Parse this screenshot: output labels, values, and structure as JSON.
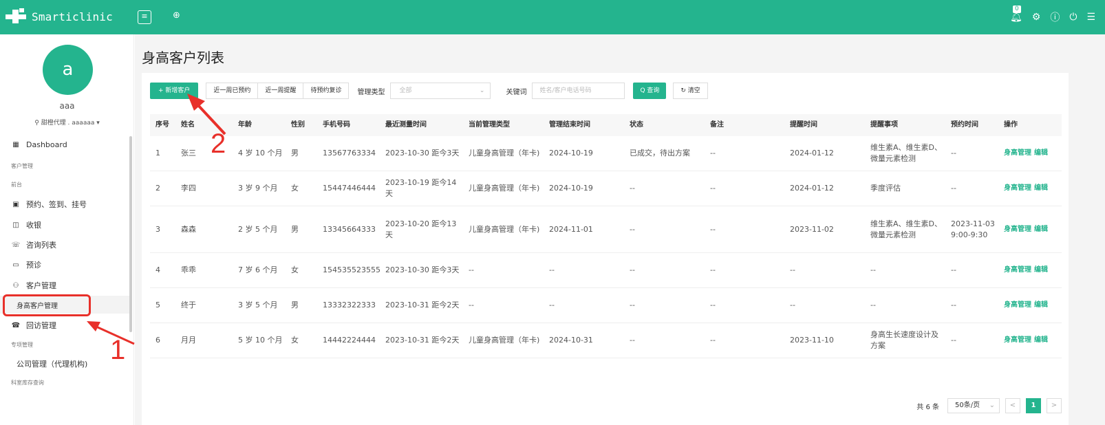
{
  "app": {
    "name": "Smarticlinic",
    "notification_count": "0"
  },
  "user": {
    "avatar_letter": "a",
    "name": "aaa",
    "location": "甜橙代理 . aaaaaa"
  },
  "sidebar": {
    "dashboard": "Dashboard",
    "sections": [
      "客户管理",
      "前台",
      "专项管理",
      "科室库存查询"
    ],
    "items": [
      "预约、签到、挂号",
      "收银",
      "咨询列表",
      "预诊",
      "客户管理",
      "身高客户管理",
      "回访管理",
      "公司管理（代理机构)"
    ]
  },
  "page": {
    "title": "身高客户列表"
  },
  "toolbar": {
    "add_label": "+ 新增客户",
    "filters": [
      "近一周已预约",
      "近一周提醒",
      "待预约复诊"
    ],
    "mgmt_type_label": "管理类型",
    "mgmt_type_value": "全部",
    "keyword_label": "关键词",
    "keyword_placeholder": "姓名/客户电话号码",
    "search_label": "Q 查询",
    "clear_label": "↻ 清空"
  },
  "table": {
    "columns": [
      "序号",
      "姓名",
      "年龄",
      "性别",
      "手机号码",
      "最近测量时间",
      "当前管理类型",
      "管理结束时间",
      "状态",
      "备注",
      "提醒时间",
      "提醒事项",
      "预约时间",
      "操作"
    ],
    "rows": [
      [
        "1",
        "张三",
        "4 岁 10 个月",
        "男",
        "13567763334",
        "2023-10-30 距今3天",
        "儿童身高管理（年卡)",
        "2024-10-19",
        "已成交，待出方案",
        "--",
        "2024-01-12",
        "维生素A、维生素D、微量元素检测",
        "--"
      ],
      [
        "2",
        "李四",
        "3 岁 9 个月",
        "女",
        "15447446444",
        "2023-10-19 距今14天",
        "儿童身高管理（年卡)",
        "2024-10-19",
        "--",
        "--",
        "2024-01-12",
        "季度评估",
        "--"
      ],
      [
        "3",
        "森森",
        "2 岁 5 个月",
        "男",
        "13345664333",
        "2023-10-20 距今13天",
        "儿童身高管理（年卡)",
        "2024-11-01",
        "--",
        "--",
        "2023-11-02",
        "维生素A、维生素D、微量元素检测",
        "2023-11-03 9:00-9:30"
      ],
      [
        "4",
        "乖乖",
        "7 岁 6 个月",
        "女",
        "154535523555",
        "2023-10-30 距今3天",
        "--",
        "--",
        "--",
        "--",
        "--",
        "--",
        "--"
      ],
      [
        "5",
        "终于",
        "3 岁 5 个月",
        "男",
        "13332322333",
        "2023-10-31 距今2天",
        "--",
        "--",
        "--",
        "--",
        "--",
        "--",
        "--"
      ],
      [
        "6",
        "月月",
        "5 岁 10 个月",
        "女",
        "14442224444",
        "2023-10-31 距今2天",
        "儿童身高管理（年卡)",
        "2024-10-31",
        "--",
        "--",
        "2023-11-10",
        "身高生长速度设计及方案",
        "--"
      ]
    ],
    "op_labels": [
      "身高管理",
      "编辑"
    ]
  },
  "pagination": {
    "total": "共 6 条",
    "page_size": "50条/页",
    "current": "1",
    "prev": "<",
    "next": ">"
  },
  "annotations": {
    "step1": "1",
    "step2": "2"
  },
  "colors": {
    "brand": "#24b48e",
    "annotation": "#e8302a"
  }
}
